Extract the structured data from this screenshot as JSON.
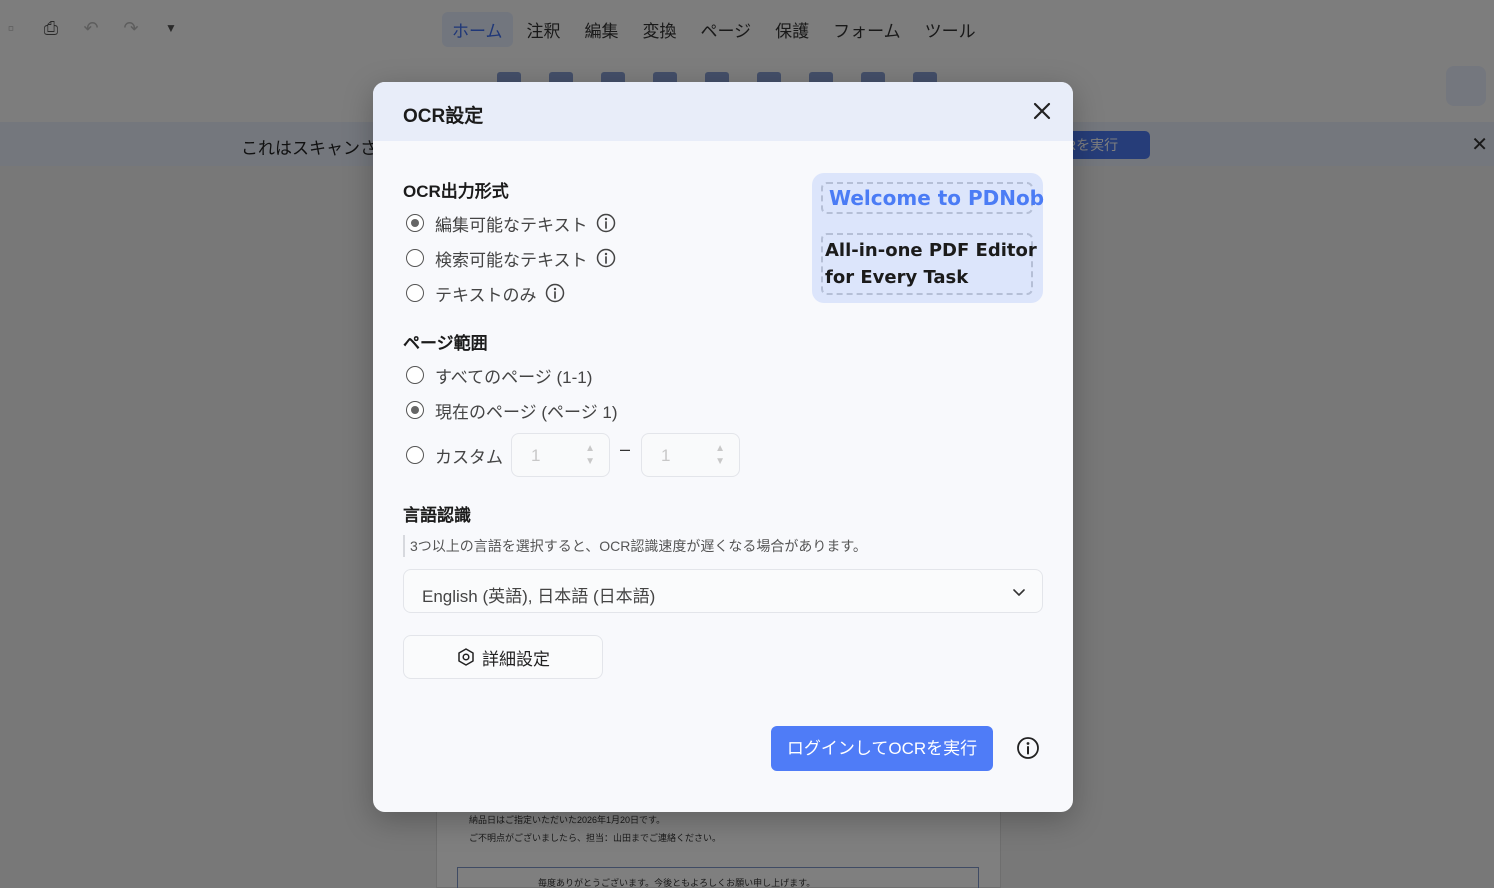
{
  "menu": {
    "items": [
      {
        "label": "ホーム",
        "active": true
      },
      {
        "label": "注釈",
        "active": false
      },
      {
        "label": "編集",
        "active": false
      },
      {
        "label": "変換",
        "active": false
      },
      {
        "label": "ページ",
        "active": false
      },
      {
        "label": "保護",
        "active": false
      },
      {
        "label": "フォーム",
        "active": false
      },
      {
        "label": "ツール",
        "active": false
      }
    ]
  },
  "quick_access": {
    "icons": [
      "save-icon",
      "print-icon",
      "undo-icon",
      "redo-icon",
      "dropdown-triangle-icon"
    ]
  },
  "banner": {
    "text": "これはスキャンさ",
    "button_label": "Rを実行"
  },
  "document": {
    "line1": "納品日はご指定いただいた2026年1月20日です。",
    "line2": "ご不明点がございましたら、担当：山田までご連絡ください。",
    "line3": "毎度ありがとうございます。今後ともよろしくお願い申し上げます。"
  },
  "dialog": {
    "title": "OCR設定",
    "output_format": {
      "title": "OCR出力形式",
      "options": [
        {
          "label": "編集可能なテキスト",
          "checked": true,
          "info": true
        },
        {
          "label": "検索可能なテキスト",
          "checked": false,
          "info": true
        },
        {
          "label": "テキストのみ",
          "checked": false,
          "info": true
        }
      ]
    },
    "promo": {
      "line1": "Welcome to PDNob",
      "line2": "All-in-one PDF Editor",
      "line3": "for Every Task"
    },
    "page_range": {
      "title": "ページ範囲",
      "options": [
        {
          "label": "すべてのページ (1-1)",
          "checked": false
        },
        {
          "label": "現在のページ (ページ 1)",
          "checked": true
        },
        {
          "label": "カスタム",
          "checked": false
        }
      ],
      "from_value": "1",
      "separator": "–",
      "to_value": "1"
    },
    "language": {
      "title": "言語認識",
      "hint": "3つ以上の言語を選択すると、OCR認識速度が遅くなる場合があります。",
      "selected": "English (英語), 日本語 (日本語)"
    },
    "advanced_label": "詳細設定",
    "run_label": "ログインしてOCRを実行"
  },
  "colors": {
    "accent": "#4f7cf7",
    "header_bg": "#e8edf9",
    "promo_bg": "#dce5fb",
    "promo_text": "#4b7cf5"
  }
}
